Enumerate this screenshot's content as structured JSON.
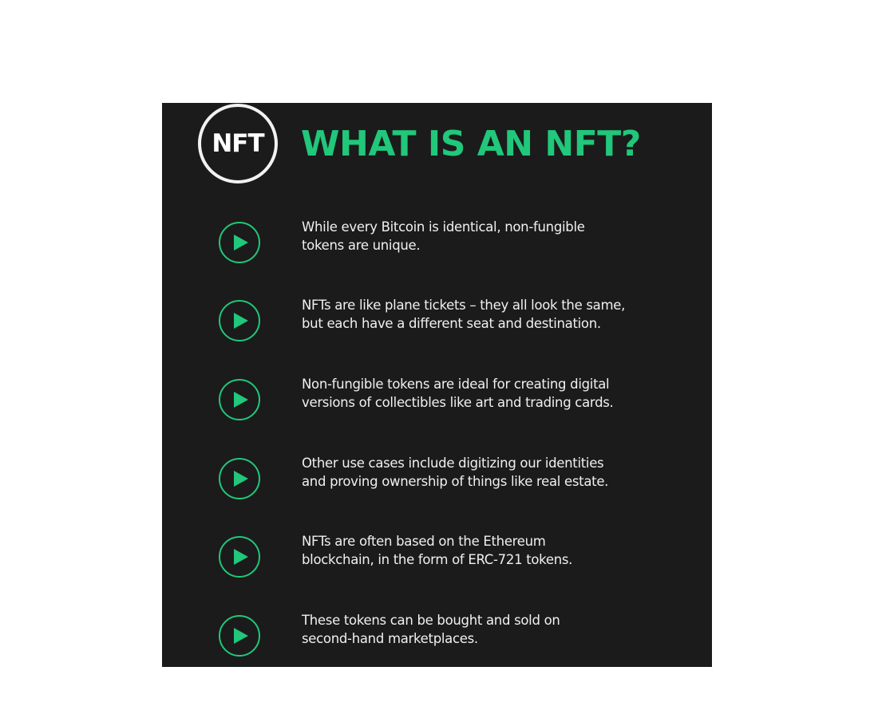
{
  "colors": {
    "accent": "#21c77a",
    "card_background": "#1b1b1b",
    "page_background": "#ffffff",
    "text": "#f0f0f0"
  },
  "header": {
    "logo_text": "NFT",
    "title": "WHAT IS AN NFT?"
  },
  "items": [
    {
      "icon": "play-arrow-circle-icon",
      "lines": [
        "While every Bitcoin is identical, non-fungible",
        "tokens are unique."
      ]
    },
    {
      "icon": "play-arrow-circle-icon",
      "lines": [
        "NFTs are like plane tickets – they all look the same,",
        "but each have a different seat and destination."
      ]
    },
    {
      "icon": "play-arrow-circle-icon",
      "lines": [
        "Non-fungible tokens are ideal for creating digital",
        "versions of collectibles like art and trading cards."
      ]
    },
    {
      "icon": "play-arrow-circle-icon",
      "lines": [
        "Other use cases include digitizing our identities",
        "and proving ownership of things like real estate."
      ]
    },
    {
      "icon": "play-arrow-circle-icon",
      "lines": [
        "NFTs are often based on the Ethereum",
        "blockchain, in the form of ERC-721 tokens."
      ]
    },
    {
      "icon": "play-arrow-circle-icon",
      "lines": [
        "These tokens can be bought and sold on",
        "second-hand marketplaces."
      ]
    }
  ]
}
